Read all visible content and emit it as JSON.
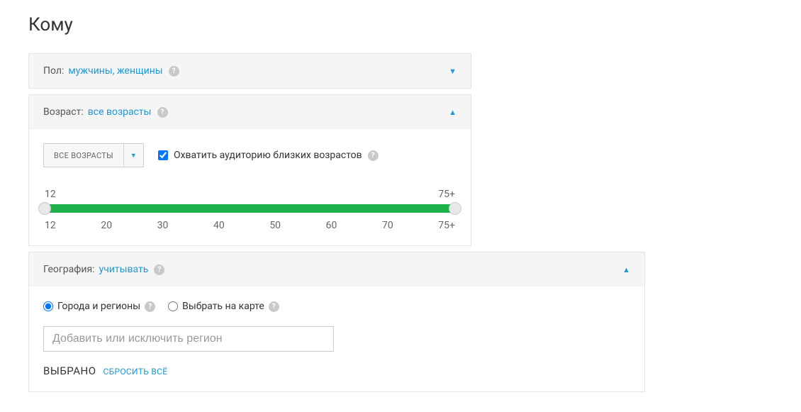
{
  "title": "Кому",
  "gender": {
    "label": "Пол:",
    "value": "мужчины, женщины",
    "collapsed": true
  },
  "age": {
    "label": "Возраст:",
    "value": "все возрасты",
    "select_text": "ВСЕ ВОЗРАСТЫ",
    "checkbox_label": "Охватить аудиторию близких возрастов",
    "checkbox_checked": true,
    "slider": {
      "min_label": "12",
      "max_label": "75+",
      "ticks": [
        "12",
        "20",
        "30",
        "40",
        "50",
        "60",
        "70",
        "75+"
      ]
    }
  },
  "geo": {
    "label": "География:",
    "value": "учитывать",
    "radio1": "Города и регионы",
    "radio2": "Выбрать на карте",
    "radio_selected": "cities",
    "input_placeholder": "Добавить или исключить регион",
    "selected_label": "ВЫБРАНО",
    "reset_label": "СБРОСИТЬ ВСЁ"
  }
}
